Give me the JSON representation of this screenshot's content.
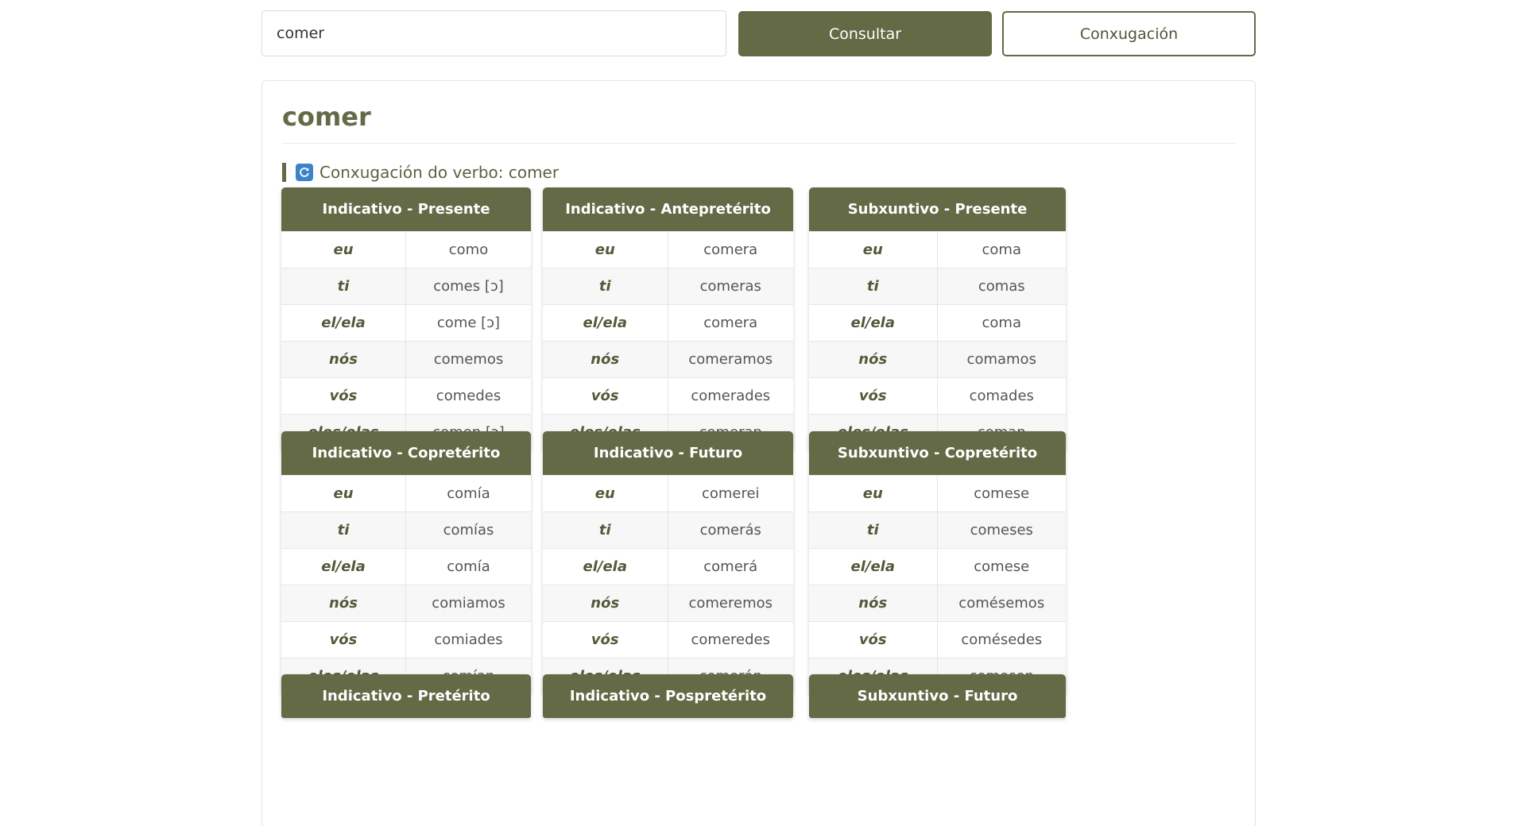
{
  "search": {
    "value": "comer"
  },
  "buttons": {
    "consultar": "Consultar",
    "conxugacion": "Conxugación"
  },
  "verb": "comer",
  "conjugation_heading": "Conxugación do verbo: comer",
  "tables": [
    {
      "title": "Indicativo - Presente",
      "rows": [
        {
          "pronoun": "eu",
          "form": "como"
        },
        {
          "pronoun": "ti",
          "form": "comes [ɔ]"
        },
        {
          "pronoun": "el/ela",
          "form": "come [ɔ]"
        },
        {
          "pronoun": "nós",
          "form": "comemos"
        },
        {
          "pronoun": "vós",
          "form": "comedes"
        },
        {
          "pronoun": "eles/elas",
          "form": "comen [ɔ]"
        }
      ]
    },
    {
      "title": "Indicativo - Antepretérito",
      "rows": [
        {
          "pronoun": "eu",
          "form": "comera"
        },
        {
          "pronoun": "ti",
          "form": "comeras"
        },
        {
          "pronoun": "el/ela",
          "form": "comera"
        },
        {
          "pronoun": "nós",
          "form": "comeramos"
        },
        {
          "pronoun": "vós",
          "form": "comerades"
        },
        {
          "pronoun": "eles/elas",
          "form": "comeran"
        }
      ]
    },
    {
      "title": "Subxuntivo - Presente",
      "rows": [
        {
          "pronoun": "eu",
          "form": "coma"
        },
        {
          "pronoun": "ti",
          "form": "comas"
        },
        {
          "pronoun": "el/ela",
          "form": "coma"
        },
        {
          "pronoun": "nós",
          "form": "comamos"
        },
        {
          "pronoun": "vós",
          "form": "comades"
        },
        {
          "pronoun": "eles/elas",
          "form": "coman"
        }
      ]
    },
    {
      "title": "Indicativo - Copretérito",
      "rows": [
        {
          "pronoun": "eu",
          "form": "comía"
        },
        {
          "pronoun": "ti",
          "form": "comías"
        },
        {
          "pronoun": "el/ela",
          "form": "comía"
        },
        {
          "pronoun": "nós",
          "form": "comiamos"
        },
        {
          "pronoun": "vós",
          "form": "comiades"
        },
        {
          "pronoun": "eles/elas",
          "form": "comían"
        }
      ]
    },
    {
      "title": "Indicativo - Futuro",
      "rows": [
        {
          "pronoun": "eu",
          "form": "comerei"
        },
        {
          "pronoun": "ti",
          "form": "comerás"
        },
        {
          "pronoun": "el/ela",
          "form": "comerá"
        },
        {
          "pronoun": "nós",
          "form": "comeremos"
        },
        {
          "pronoun": "vós",
          "form": "comeredes"
        },
        {
          "pronoun": "eles/elas",
          "form": "comerán"
        }
      ]
    },
    {
      "title": "Subxuntivo - Copretérito",
      "rows": [
        {
          "pronoun": "eu",
          "form": "comese"
        },
        {
          "pronoun": "ti",
          "form": "comeses"
        },
        {
          "pronoun": "el/ela",
          "form": "comese"
        },
        {
          "pronoun": "nós",
          "form": "comésemos"
        },
        {
          "pronoun": "vós",
          "form": "comésedes"
        },
        {
          "pronoun": "eles/elas",
          "form": "comesen"
        }
      ]
    },
    {
      "title": "Indicativo - Pretérito",
      "rows": []
    },
    {
      "title": "Indicativo - Pospretérito",
      "rows": []
    },
    {
      "title": "Subxuntivo - Futuro",
      "rows": []
    }
  ],
  "colors": {
    "accent": "#636a45",
    "refresh_icon": "#3c83c8"
  },
  "icons": {
    "heading_icon": "refresh-icon"
  }
}
